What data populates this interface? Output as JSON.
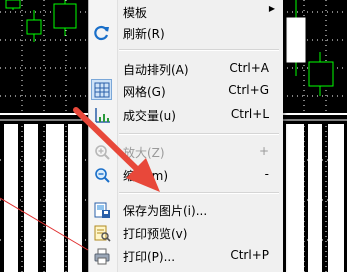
{
  "menu": {
    "items": [
      {
        "label": "模板",
        "shortcut": "",
        "submenu": true,
        "icon": "none",
        "disabled": false
      },
      {
        "label": "刷新(R)",
        "shortcut": "",
        "icon": "refresh-icon",
        "disabled": false
      },
      {
        "label": "自动排列(A)",
        "shortcut": "Ctrl+A",
        "icon": "none",
        "disabled": false
      },
      {
        "label": "网格(G)",
        "shortcut": "Ctrl+G",
        "icon": "grid-icon",
        "checked": true,
        "disabled": false
      },
      {
        "label": "成交量(u)",
        "shortcut": "Ctrl+L",
        "icon": "volume-icon",
        "disabled": false
      },
      {
        "label": "放大(Z)",
        "shortcut": "+",
        "icon": "zoom-in-icon",
        "disabled": true
      },
      {
        "label": "缩小(m)",
        "shortcut": "-",
        "icon": "zoom-out-icon",
        "disabled": false
      },
      {
        "label": "保存为图片(i)...",
        "shortcut": "",
        "icon": "save-image-icon",
        "disabled": false
      },
      {
        "label": "打印预览(v)",
        "shortcut": "",
        "icon": "print-preview-icon",
        "disabled": false
      },
      {
        "label": "打印(P)...",
        "shortcut": "Ctrl+P",
        "icon": "printer-icon",
        "disabled": false
      }
    ]
  },
  "colors": {
    "chart_background": "#000000",
    "candle_green": "#00ff00",
    "grid_white": "#ffffff",
    "annotation_arrow": "#e8483a",
    "menu_background": "#f0f0f0"
  }
}
